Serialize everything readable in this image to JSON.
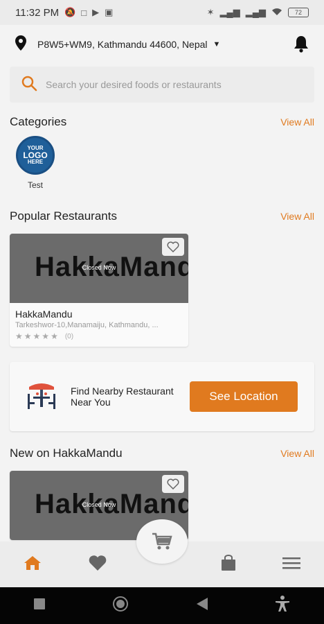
{
  "status_bar": {
    "time": "11:32 PM",
    "battery": "72"
  },
  "location": {
    "address": "P8W5+WM9, Kathmandu 44600, Nepal"
  },
  "search": {
    "placeholder": "Search your desired foods or restaurants"
  },
  "categories": {
    "title": "Categories",
    "view_all": "View All",
    "items": [
      {
        "label": "Test",
        "logo_line1": "YOUR",
        "logo_line2": "LOGO",
        "logo_line3": "HERE"
      }
    ]
  },
  "popular": {
    "title": "Popular Restaurants",
    "view_all": "View All",
    "restaurants": [
      {
        "image_text": "HakkaMandu",
        "status": "Closed Now",
        "name": "HakkaMandu",
        "address": "Tarkeshwor-10,Manamaiju, Kathmandu, ...",
        "rating_count": "(0)"
      }
    ]
  },
  "nearby": {
    "text": "Find Nearby Restaurant Near You",
    "button": "See Location"
  },
  "new_on": {
    "title": "New on HakkaMandu",
    "view_all": "View All",
    "restaurants": [
      {
        "image_text": "HakkaMandu",
        "status": "Closed Now"
      }
    ]
  },
  "colors": {
    "accent": "#e07a1f",
    "card_image": "#6b6b6b",
    "logo": "#1f5f99"
  },
  "icons": {
    "location": "location-pin-icon",
    "notification": "bell-icon",
    "search": "search-icon",
    "favorite": "heart-outline-icon",
    "cart": "cart-icon",
    "nav": [
      "home-icon",
      "heart-icon",
      "bag-icon",
      "menu-icon"
    ]
  }
}
